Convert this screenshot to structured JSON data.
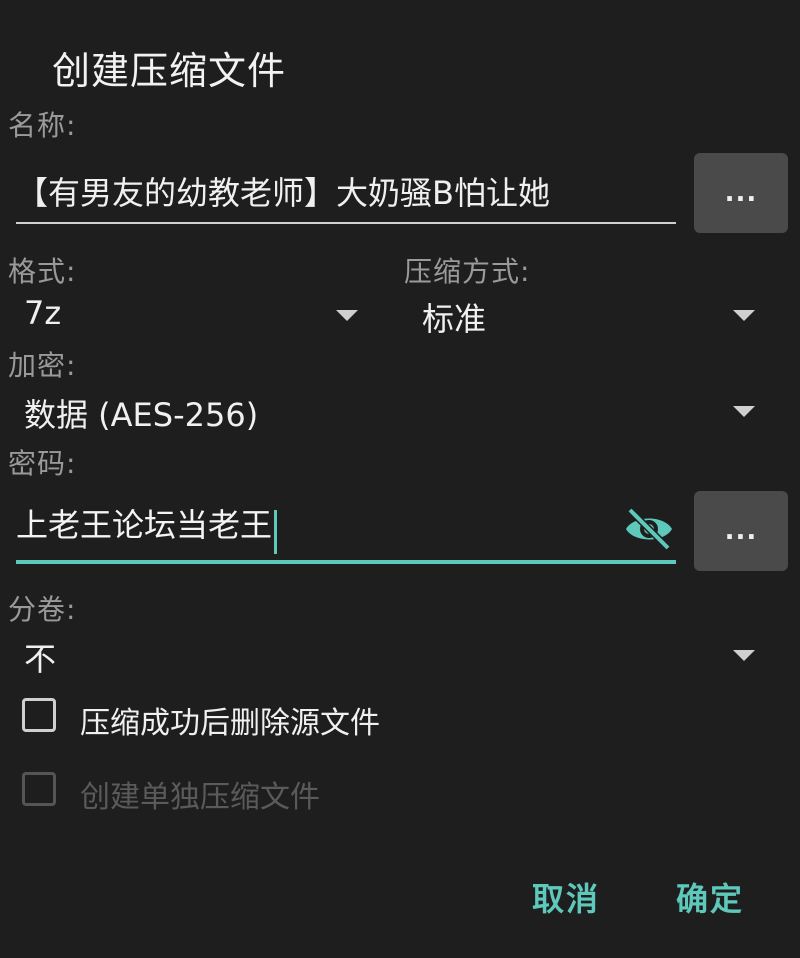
{
  "dialog": {
    "title": "创建压缩文件"
  },
  "name": {
    "label": "名称:",
    "value": "【有男友的幼教老师】大奶骚B怕让她",
    "more_label": "..."
  },
  "format": {
    "label": "格式:",
    "value": "7z"
  },
  "compression": {
    "label": "压缩方式:",
    "value": "标准"
  },
  "encryption": {
    "label": "加密:",
    "value": "数据 (AES-256)"
  },
  "password": {
    "label": "密码:",
    "value": "上老王论坛当老王",
    "more_label": "...",
    "visibility_icon": "eye-off-icon"
  },
  "split": {
    "label": "分卷:",
    "value": "不"
  },
  "options": {
    "delete_source_label": "压缩成功后删除源文件",
    "delete_source_checked": false,
    "separate_archives_label": "创建单独压缩文件",
    "separate_archives_checked": false,
    "separate_archives_enabled": false
  },
  "actions": {
    "cancel_label": "取消",
    "ok_label": "确定"
  },
  "colors": {
    "accent": "#5ec9bb",
    "background": "#1e1e1f",
    "button_bg": "#4a4a4b"
  }
}
